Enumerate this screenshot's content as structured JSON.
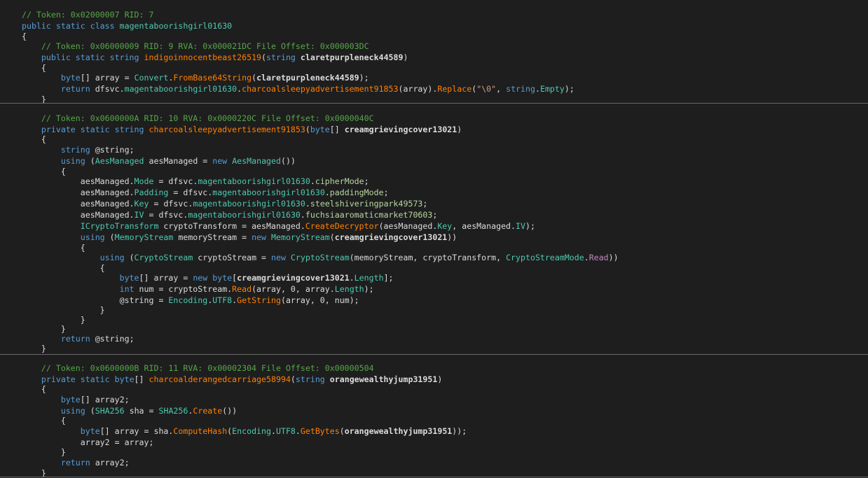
{
  "code_view": {
    "lines": [
      [
        {
          "t": "// Token: 0x02000007 RID: 7",
          "k": "comment"
        }
      ],
      [
        {
          "t": "public static class ",
          "k": "keyword"
        },
        {
          "t": "magentaboorishgirl01630",
          "k": "typename"
        }
      ],
      [
        {
          "t": "{",
          "k": "plain"
        }
      ],
      [
        {
          "t": "    // Token: 0x06000009 RID: 9 RVA: 0x000021DC File Offset: 0x000003DC",
          "k": "comment"
        }
      ],
      [
        {
          "t": "    public static string ",
          "k": "keyword"
        },
        {
          "t": "indigoinnocentbeast26519",
          "k": "method"
        },
        {
          "t": "(",
          "k": "plain"
        },
        {
          "t": "string ",
          "k": "keyword"
        },
        {
          "t": "claretpurpleneck44589",
          "k": "param"
        },
        {
          "t": ")",
          "k": "plain"
        }
      ],
      [
        {
          "t": "    {",
          "k": "plain"
        }
      ],
      [
        {
          "t": "        byte",
          "k": "keyword"
        },
        {
          "t": "[] array = ",
          "k": "plain"
        },
        {
          "t": "Convert",
          "k": "typename"
        },
        {
          "t": ".",
          "k": "plain"
        },
        {
          "t": "FromBase64String",
          "k": "method"
        },
        {
          "t": "(",
          "k": "plain"
        },
        {
          "t": "claretpurpleneck44589",
          "k": "param"
        },
        {
          "t": ");",
          "k": "plain"
        }
      ],
      [
        {
          "t": "        return ",
          "k": "keyword"
        },
        {
          "t": "dfsvc",
          "k": "namespace"
        },
        {
          "t": ".",
          "k": "plain"
        },
        {
          "t": "magentaboorishgirl01630",
          "k": "typename"
        },
        {
          "t": ".",
          "k": "plain"
        },
        {
          "t": "charcoalsleepyadvertisement91853",
          "k": "method"
        },
        {
          "t": "(array).",
          "k": "plain"
        },
        {
          "t": "Replace",
          "k": "method"
        },
        {
          "t": "(",
          "k": "plain"
        },
        {
          "t": "\"\\0\"",
          "k": "string"
        },
        {
          "t": ", ",
          "k": "plain"
        },
        {
          "t": "string",
          "k": "keyword"
        },
        {
          "t": ".",
          "k": "plain"
        },
        {
          "t": "Empty",
          "k": "property"
        },
        {
          "t": ");",
          "k": "plain"
        }
      ],
      [
        {
          "t": "    }",
          "k": "plain"
        }
      ],
      [
        {
          "t": "    // Token: 0x0600000A RID: 10 RVA: 0x0000220C File Offset: 0x0000040C",
          "k": "comment"
        }
      ],
      [
        {
          "t": "    private static string ",
          "k": "keyword"
        },
        {
          "t": "charcoalsleepyadvertisement91853",
          "k": "method"
        },
        {
          "t": "(",
          "k": "plain"
        },
        {
          "t": "byte",
          "k": "keyword"
        },
        {
          "t": "[] ",
          "k": "plain"
        },
        {
          "t": "creamgrievingcover13021",
          "k": "param"
        },
        {
          "t": ")",
          "k": "plain"
        }
      ],
      [
        {
          "t": "    {",
          "k": "plain"
        }
      ],
      [
        {
          "t": "        string ",
          "k": "keyword"
        },
        {
          "t": "@string;",
          "k": "plain"
        }
      ],
      [
        {
          "t": "        using ",
          "k": "keyword"
        },
        {
          "t": "(",
          "k": "plain"
        },
        {
          "t": "AesManaged",
          "k": "typename"
        },
        {
          "t": " aesManaged = ",
          "k": "plain"
        },
        {
          "t": "new ",
          "k": "keyword"
        },
        {
          "t": "AesManaged",
          "k": "typename"
        },
        {
          "t": "())",
          "k": "plain"
        }
      ],
      [
        {
          "t": "        {",
          "k": "plain"
        }
      ],
      [
        {
          "t": "            aesManaged.",
          "k": "plain"
        },
        {
          "t": "Mode",
          "k": "property"
        },
        {
          "t": " = ",
          "k": "plain"
        },
        {
          "t": "dfsvc",
          "k": "namespace"
        },
        {
          "t": ".",
          "k": "plain"
        },
        {
          "t": "magentaboorishgirl01630",
          "k": "typename"
        },
        {
          "t": ".",
          "k": "plain"
        },
        {
          "t": "cipherMode",
          "k": "enummember"
        },
        {
          "t": ";",
          "k": "plain"
        }
      ],
      [
        {
          "t": "            aesManaged.",
          "k": "plain"
        },
        {
          "t": "Padding",
          "k": "property"
        },
        {
          "t": " = ",
          "k": "plain"
        },
        {
          "t": "dfsvc",
          "k": "namespace"
        },
        {
          "t": ".",
          "k": "plain"
        },
        {
          "t": "magentaboorishgirl01630",
          "k": "typename"
        },
        {
          "t": ".",
          "k": "plain"
        },
        {
          "t": "paddingMode",
          "k": "enummember"
        },
        {
          "t": ";",
          "k": "plain"
        }
      ],
      [
        {
          "t": "            aesManaged.",
          "k": "plain"
        },
        {
          "t": "Key",
          "k": "property"
        },
        {
          "t": " = ",
          "k": "plain"
        },
        {
          "t": "dfsvc",
          "k": "namespace"
        },
        {
          "t": ".",
          "k": "plain"
        },
        {
          "t": "magentaboorishgirl01630",
          "k": "typename"
        },
        {
          "t": ".",
          "k": "plain"
        },
        {
          "t": "steelshiveringpark49573",
          "k": "enummember"
        },
        {
          "t": ";",
          "k": "plain"
        }
      ],
      [
        {
          "t": "            aesManaged.",
          "k": "plain"
        },
        {
          "t": "IV",
          "k": "property"
        },
        {
          "t": " = ",
          "k": "plain"
        },
        {
          "t": "dfsvc",
          "k": "namespace"
        },
        {
          "t": ".",
          "k": "plain"
        },
        {
          "t": "magentaboorishgirl01630",
          "k": "typename"
        },
        {
          "t": ".",
          "k": "plain"
        },
        {
          "t": "fuchsiaaromaticmarket70603",
          "k": "enummember"
        },
        {
          "t": ";",
          "k": "plain"
        }
      ],
      [
        {
          "t": "            ",
          "k": "plain"
        },
        {
          "t": "ICryptoTransform",
          "k": "typename"
        },
        {
          "t": " cryptoTransform = aesManaged.",
          "k": "plain"
        },
        {
          "t": "CreateDecryptor",
          "k": "method"
        },
        {
          "t": "(aesManaged.",
          "k": "plain"
        },
        {
          "t": "Key",
          "k": "property"
        },
        {
          "t": ", aesManaged.",
          "k": "plain"
        },
        {
          "t": "IV",
          "k": "property"
        },
        {
          "t": ");",
          "k": "plain"
        }
      ],
      [
        {
          "t": "            using ",
          "k": "keyword"
        },
        {
          "t": "(",
          "k": "plain"
        },
        {
          "t": "MemoryStream",
          "k": "typename"
        },
        {
          "t": " memoryStream = ",
          "k": "plain"
        },
        {
          "t": "new ",
          "k": "keyword"
        },
        {
          "t": "MemoryStream",
          "k": "typename"
        },
        {
          "t": "(",
          "k": "plain"
        },
        {
          "t": "creamgrievingcover13021",
          "k": "param"
        },
        {
          "t": "))",
          "k": "plain"
        }
      ],
      [
        {
          "t": "            {",
          "k": "plain"
        }
      ],
      [
        {
          "t": "                using ",
          "k": "keyword"
        },
        {
          "t": "(",
          "k": "plain"
        },
        {
          "t": "CryptoStream",
          "k": "typename"
        },
        {
          "t": " cryptoStream = ",
          "k": "plain"
        },
        {
          "t": "new ",
          "k": "keyword"
        },
        {
          "t": "CryptoStream",
          "k": "typename"
        },
        {
          "t": "(memoryStream, cryptoTransform, ",
          "k": "plain"
        },
        {
          "t": "CryptoStreamMode",
          "k": "typename"
        },
        {
          "t": ".",
          "k": "plain"
        },
        {
          "t": "Read",
          "k": "enumval"
        },
        {
          "t": "))",
          "k": "plain"
        }
      ],
      [
        {
          "t": "                {",
          "k": "plain"
        }
      ],
      [
        {
          "t": "                    byte",
          "k": "keyword"
        },
        {
          "t": "[] array = ",
          "k": "plain"
        },
        {
          "t": "new ",
          "k": "keyword"
        },
        {
          "t": "byte",
          "k": "keyword"
        },
        {
          "t": "[",
          "k": "plain"
        },
        {
          "t": "creamgrievingcover13021",
          "k": "param"
        },
        {
          "t": ".",
          "k": "plain"
        },
        {
          "t": "Length",
          "k": "property"
        },
        {
          "t": "];",
          "k": "plain"
        }
      ],
      [
        {
          "t": "                    int ",
          "k": "keyword"
        },
        {
          "t": "num = cryptoStream.",
          "k": "plain"
        },
        {
          "t": "Read",
          "k": "method"
        },
        {
          "t": "(array, 0, array.",
          "k": "plain"
        },
        {
          "t": "Length",
          "k": "property"
        },
        {
          "t": ");",
          "k": "plain"
        }
      ],
      [
        {
          "t": "                    @string = ",
          "k": "plain"
        },
        {
          "t": "Encoding",
          "k": "typename"
        },
        {
          "t": ".",
          "k": "plain"
        },
        {
          "t": "UTF8",
          "k": "property"
        },
        {
          "t": ".",
          "k": "plain"
        },
        {
          "t": "GetString",
          "k": "method"
        },
        {
          "t": "(array, 0, num);",
          "k": "plain"
        }
      ],
      [
        {
          "t": "                }",
          "k": "plain"
        }
      ],
      [
        {
          "t": "            }",
          "k": "plain"
        }
      ],
      [
        {
          "t": "        }",
          "k": "plain"
        }
      ],
      [
        {
          "t": "        return ",
          "k": "keyword"
        },
        {
          "t": "@string;",
          "k": "plain"
        }
      ],
      [
        {
          "t": "    }",
          "k": "plain"
        }
      ],
      [
        {
          "t": "    // Token: 0x0600000B RID: 11 RVA: 0x00002304 File Offset: 0x00000504",
          "k": "comment"
        }
      ],
      [
        {
          "t": "    private static ",
          "k": "keyword"
        },
        {
          "t": "byte",
          "k": "keyword"
        },
        {
          "t": "[] ",
          "k": "plain"
        },
        {
          "t": "charcoalderangedcarriage58994",
          "k": "method"
        },
        {
          "t": "(",
          "k": "plain"
        },
        {
          "t": "string ",
          "k": "keyword"
        },
        {
          "t": "orangewealthyjump31951",
          "k": "param"
        },
        {
          "t": ")",
          "k": "plain"
        }
      ],
      [
        {
          "t": "    {",
          "k": "plain"
        }
      ],
      [
        {
          "t": "        byte",
          "k": "keyword"
        },
        {
          "t": "[] array2;",
          "k": "plain"
        }
      ],
      [
        {
          "t": "        using ",
          "k": "keyword"
        },
        {
          "t": "(",
          "k": "plain"
        },
        {
          "t": "SHA256",
          "k": "typename"
        },
        {
          "t": " sha = ",
          "k": "plain"
        },
        {
          "t": "SHA256",
          "k": "typename"
        },
        {
          "t": ".",
          "k": "plain"
        },
        {
          "t": "Create",
          "k": "method"
        },
        {
          "t": "())",
          "k": "plain"
        }
      ],
      [
        {
          "t": "        {",
          "k": "plain"
        }
      ],
      [
        {
          "t": "            byte",
          "k": "keyword"
        },
        {
          "t": "[] array = sha.",
          "k": "plain"
        },
        {
          "t": "ComputeHash",
          "k": "method"
        },
        {
          "t": "(",
          "k": "plain"
        },
        {
          "t": "Encoding",
          "k": "typename"
        },
        {
          "t": ".",
          "k": "plain"
        },
        {
          "t": "UTF8",
          "k": "property"
        },
        {
          "t": ".",
          "k": "plain"
        },
        {
          "t": "GetBytes",
          "k": "method"
        },
        {
          "t": "(",
          "k": "plain"
        },
        {
          "t": "orangewealthyjump31951",
          "k": "param"
        },
        {
          "t": "));",
          "k": "plain"
        }
      ],
      [
        {
          "t": "            array2 = array;",
          "k": "plain"
        }
      ],
      [
        {
          "t": "        }",
          "k": "plain"
        }
      ],
      [
        {
          "t": "        return ",
          "k": "keyword"
        },
        {
          "t": "array2;",
          "k": "plain"
        }
      ],
      [
        {
          "t": "    }",
          "k": "plain"
        }
      ]
    ]
  }
}
